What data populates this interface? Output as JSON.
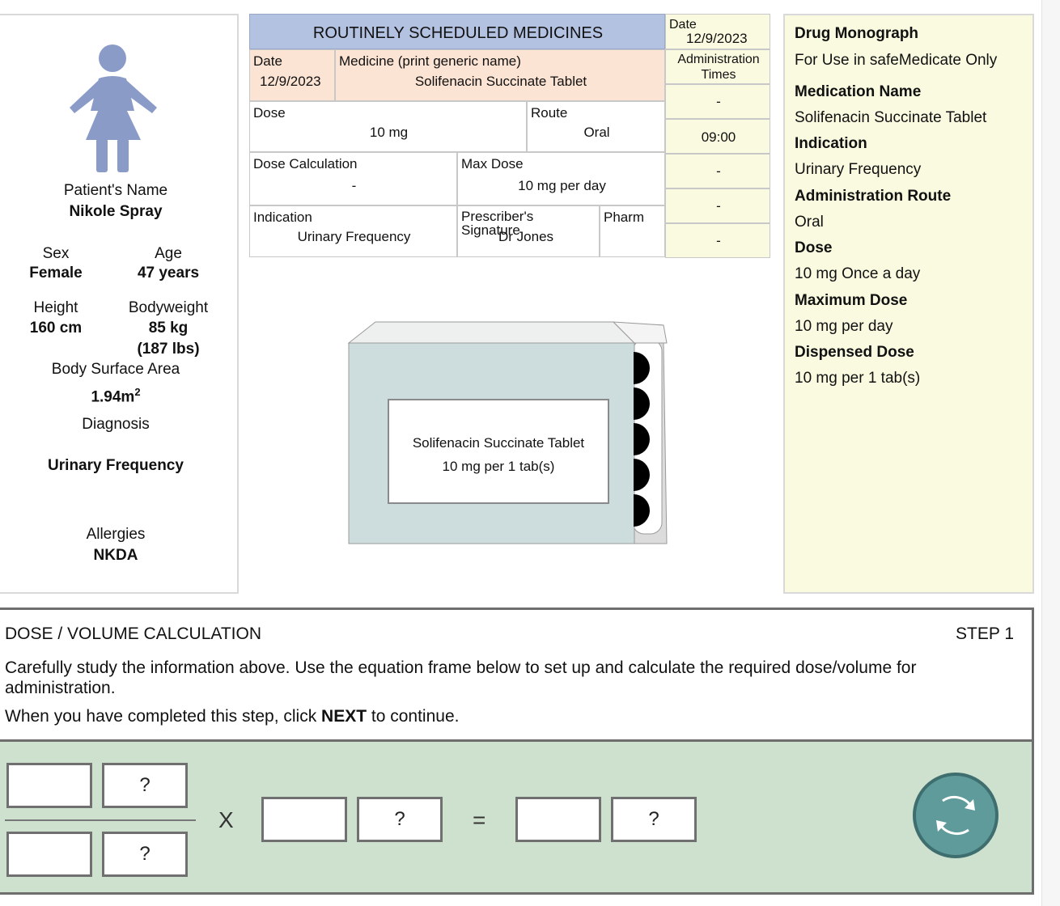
{
  "patient": {
    "name_label": "Patient's Name",
    "name": "Nikole Spray",
    "sex_label": "Sex",
    "sex": "Female",
    "age_label": "Age",
    "age": "47 years",
    "height_label": "Height",
    "height": "160 cm",
    "bodyweight_label": "Bodyweight",
    "bodyweight": "85 kg",
    "bodyweight_lbs": "(187 lbs)",
    "bsa_label": "Body Surface Area",
    "bsa_value": "1.94m",
    "bsa_sup": "2",
    "diagnosis_label": "Diagnosis",
    "diagnosis": "Urinary Frequency",
    "allergies_label": "Allergies",
    "allergies": "NKDA",
    "avatar_icon": "patient-female-icon",
    "avatar_color": "#8a9bc8"
  },
  "chart": {
    "title": "ROUTINELY SCHEDULED MEDICINES",
    "date_label": "Date",
    "date": "12/9/2023",
    "medicine_label": "Medicine (print generic name)",
    "medicine": "Solifenacin Succinate Tablet",
    "dose_label": "Dose",
    "dose": "10 mg",
    "route_label": "Route",
    "route": "Oral",
    "dose_calc_label": "Dose Calculation",
    "dose_calc": "-",
    "max_dose_label": "Max Dose",
    "max_dose": "10 mg per day",
    "indication_label": "Indication",
    "indication": "Urinary Frequency",
    "prescriber_label": "Prescriber's Signature",
    "prescriber": "Dr Jones",
    "pharm_label": "Pharm",
    "admin_date_label": "Date",
    "admin_date": "12/9/2023",
    "admin_times_label": "Administration Times",
    "admin_times": [
      "-",
      "09:00",
      "-",
      "-",
      "-"
    ],
    "header_color": "#b4c2e2",
    "medicine_row_color": "#fce4d4"
  },
  "package": {
    "name": "Solifenacin Succinate Tablet",
    "strength": "10 mg per 1 tab(s)",
    "box_color": "#cddcdc"
  },
  "monograph": {
    "title": "Drug Monograph",
    "subtitle": "For Use in safeMedicate Only",
    "med_name_label": "Medication Name",
    "med_name": "Solifenacin Succinate Tablet",
    "indication_label": "Indication",
    "indication": "Urinary Frequency",
    "route_label": "Administration Route",
    "route": "Oral",
    "dose_label": "Dose",
    "dose": "10 mg Once a day",
    "max_dose_label": "Maximum Dose",
    "max_dose": "10 mg per day",
    "dispensed_label": "Dispensed Dose",
    "dispensed": "10 mg per 1 tab(s)"
  },
  "instructions": {
    "heading": "DOSE / VOLUME CALCULATION",
    "step": "STEP 1",
    "line1": "Carefully study the information above. Use the equation frame below to set up and calculate the required dose/volume for administration.",
    "line2_pre": "When you have completed this step, click ",
    "line2_bold": "NEXT",
    "line2_post": " to continue."
  },
  "equation": {
    "unit_placeholder": "?",
    "times_symbol": "X",
    "equals_symbol": "=",
    "refresh_icon": "refresh-icon"
  }
}
